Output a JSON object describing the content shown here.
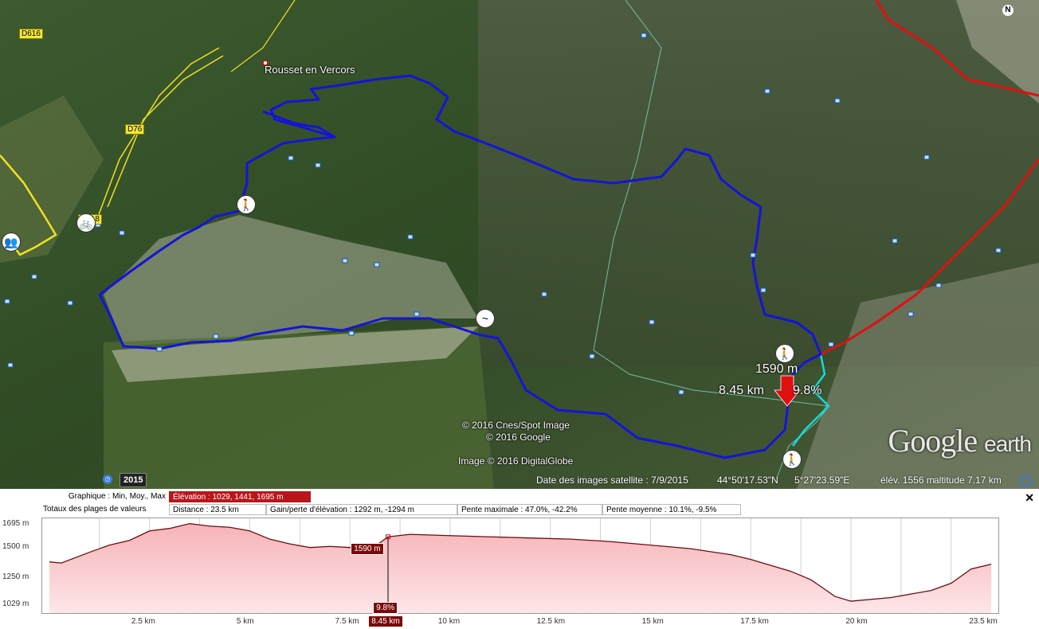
{
  "map": {
    "place_label": "Rousset en Vercors",
    "road_labels": [
      "D616",
      "D76",
      "D518"
    ],
    "copyright_1": "© 2016 Cnes/Spot Image",
    "copyright_2": "© 2016 Google",
    "copyright_3": "Image © 2016 DigitalGlobe",
    "logo_google": "Google",
    "logo_earth": "earth",
    "cursor_elevation": "1590 m",
    "cursor_distance": "8.45 km",
    "cursor_slope": "9.8%",
    "compass_label": "N",
    "year_badge": "2015",
    "status": {
      "imagery_date": "Date des images satellite : 7/9/2015",
      "lat": "44°50'17.53\"N",
      "lon": "5°27'23.59\"E",
      "elev": "élév. 1556 m",
      "altitude": "altitude   7.17 km"
    },
    "colors": {
      "track": "#1414d8",
      "border_red": "#e01010",
      "road_yellow": "#f0e020",
      "trail_cyan": "#00d8d8"
    }
  },
  "profile": {
    "graph_label": "Graphique : Min, Moy., Max",
    "elevation_summary": "Élévation : 1029, 1441, 1695 m",
    "totals_label": "Totaux des plages de valeurs",
    "distance": "Distance : 23.5 km",
    "gain_loss": "Gain/perte d'élévation : 1292 m, -1294 m",
    "max_slope": "Pente maximale : 47.0%, -42.2%",
    "avg_slope": "Pente moyenne : 10.1%, -9.5%",
    "close_label": "✕",
    "marker_elevation": "1590 m",
    "marker_slope": "9.8%",
    "marker_distance": "8.45 km"
  },
  "chart_data": {
    "type": "area",
    "xlabel": "",
    "ylabel": "",
    "xlim": [
      0,
      23.5
    ],
    "ylim": [
      1029,
      1695
    ],
    "x_ticks": [
      "2.5 km",
      "5 km",
      "7.5 km",
      "10 km",
      "12.5 km",
      "15 km",
      "17.5 km",
      "20 km",
      "23.5 km"
    ],
    "y_ticks": [
      "1695 m",
      "1500 m",
      "1250 m",
      "1029 m"
    ],
    "series": [
      {
        "x": [
          0,
          0.3,
          1,
          1.5,
          2,
          2.5,
          3,
          3.5,
          4,
          4.5,
          5,
          5.5,
          6,
          6.5,
          7,
          7.5,
          7.8,
          8,
          8.45,
          9,
          10,
          11,
          12,
          13,
          14,
          15,
          16,
          17,
          17.5,
          18,
          18.5,
          19,
          19.3,
          19.6,
          20,
          21,
          22,
          22.5,
          23,
          23.5
        ],
        "values": [
          1380,
          1370,
          1460,
          1520,
          1560,
          1640,
          1660,
          1700,
          1680,
          1670,
          1640,
          1570,
          1530,
          1500,
          1510,
          1500,
          1440,
          1480,
          1590,
          1610,
          1600,
          1590,
          1580,
          1570,
          1550,
          1520,
          1490,
          1440,
          1400,
          1350,
          1300,
          1230,
          1160,
          1090,
          1050,
          1080,
          1140,
          1200,
          1320,
          1360
        ]
      }
    ],
    "marker": {
      "x": 8.45,
      "y": 1590
    }
  }
}
